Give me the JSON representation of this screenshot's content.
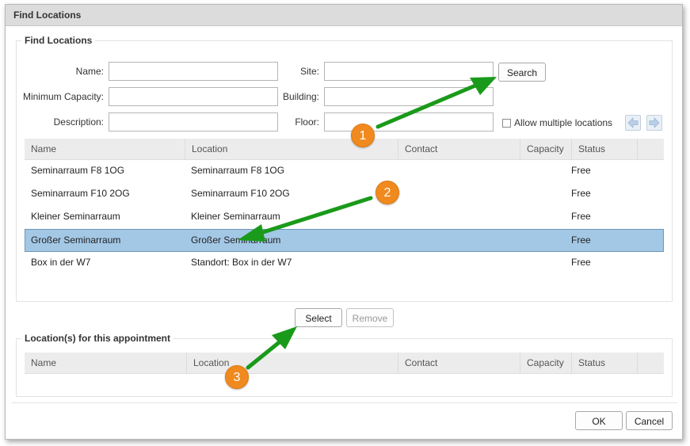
{
  "window": {
    "title": "Find Locations"
  },
  "search": {
    "legend": "Find Locations",
    "name_label": "Name:",
    "min_capacity_label": "Minimum Capacity:",
    "description_label": "Description:",
    "site_label": "Site:",
    "building_label": "Building:",
    "floor_label": "Floor:",
    "name_value": "",
    "min_capacity_value": "",
    "description_value": "",
    "site_value": "",
    "building_value": "",
    "floor_value": "",
    "search_button": "Search",
    "allow_multiple_label": "Allow multiple locations",
    "allow_multiple_checked": false
  },
  "results": {
    "columns": [
      "Name",
      "Location",
      "Contact",
      "Capacity",
      "Status"
    ],
    "rows": [
      {
        "name": "Seminarraum F8 1OG",
        "location": "Seminarraum F8 1OG",
        "contact": "",
        "capacity": "",
        "status": "Free",
        "selected": false
      },
      {
        "name": "Seminarraum F10 2OG",
        "location": "Seminarraum F10 2OG",
        "contact": "",
        "capacity": "",
        "status": "Free",
        "selected": false
      },
      {
        "name": "Kleiner Seminarraum",
        "location": "Kleiner Seminarraum",
        "contact": "",
        "capacity": "",
        "status": "Free",
        "selected": false
      },
      {
        "name": "Großer Seminarraum",
        "location": "Großer Seminarraum",
        "contact": "",
        "capacity": "",
        "status": "Free",
        "selected": true
      },
      {
        "name": "Box in der W7",
        "location": "Standort: Box in der W7",
        "contact": "",
        "capacity": "",
        "status": "Free",
        "selected": false
      }
    ]
  },
  "actions": {
    "select_button": "Select",
    "remove_button": "Remove"
  },
  "assigned": {
    "legend": "Location(s) for this appointment",
    "columns": [
      "Name",
      "Location",
      "Contact",
      "Capacity",
      "Status"
    ]
  },
  "footer": {
    "ok_button": "OK",
    "cancel_button": "Cancel"
  },
  "annotations": {
    "badges": [
      "1",
      "2",
      "3"
    ],
    "arrow_color": "#1a9a1a",
    "badge_color": "#f08a1e"
  },
  "colors": {
    "selection": "#a3c8e6",
    "header": "#ececec",
    "titlebar": "#dcdcdc"
  }
}
